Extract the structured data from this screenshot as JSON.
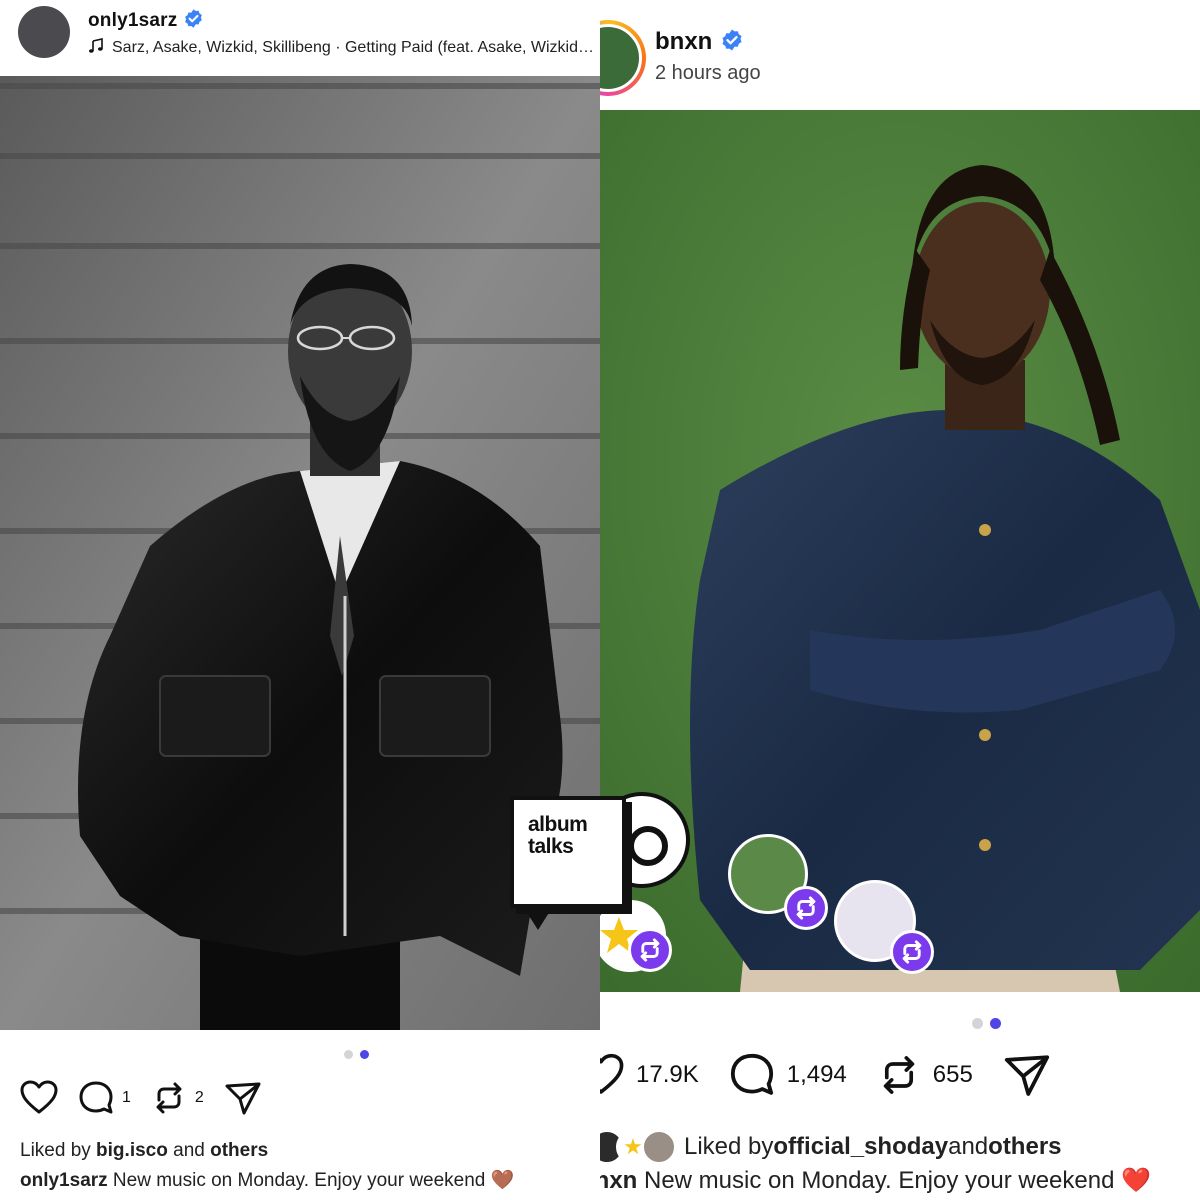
{
  "left_post": {
    "username": "only1sarz",
    "music": "Sarz, Asake, Wizkid, Skillibeng · Getting Paid (feat. Asake, Wizkid & Skillibeng)",
    "actions": {
      "comments": "1",
      "reposts": "2"
    },
    "liked_by": {
      "prefix": "Liked by ",
      "user": "big.isco",
      "and": " and ",
      "others": "others"
    },
    "caption": {
      "user": "only1sarz",
      "text": " New music on Monday. Enjoy your weekend 🤎"
    },
    "carousel": {
      "count": 2,
      "active_index": 1
    }
  },
  "right_post": {
    "username": "bnxn",
    "time": "2 hours ago",
    "actions": {
      "likes": "17.9K",
      "comments": "1,494",
      "reposts": "655"
    },
    "liked_by": {
      "prefix": "Liked by ",
      "user": "official_shoday",
      "and": " and ",
      "others": "others"
    },
    "caption": {
      "user": "bnxn",
      "text": " New music on Monday. Enjoy your weekend ❤️"
    },
    "carousel": {
      "count": 2,
      "active_index": 1
    }
  },
  "overlay": {
    "logo_line1": "album",
    "logo_line2": "talks"
  },
  "colors": {
    "accent": "#4f46e5",
    "verified": "#3b82f6",
    "repost_badge": "#7c3aed",
    "green_backdrop": "#4d7d3c"
  },
  "icons": {
    "verified": "verified-badge-icon",
    "music": "music-note-icon",
    "like": "heart-icon",
    "comment": "comment-bubble-icon",
    "repost": "repost-arrows-icon",
    "share": "paper-plane-icon"
  }
}
